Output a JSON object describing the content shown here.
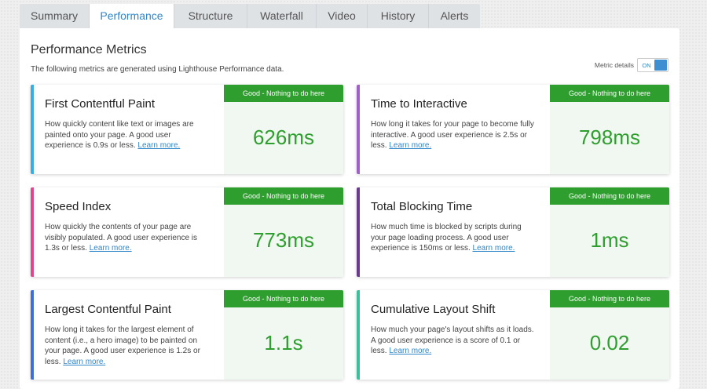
{
  "tabs": [
    {
      "label": "Summary",
      "active": false
    },
    {
      "label": "Performance",
      "active": true
    },
    {
      "label": "Structure",
      "active": false
    },
    {
      "label": "Waterfall",
      "active": false
    },
    {
      "label": "Video",
      "active": false
    },
    {
      "label": "History",
      "active": false
    },
    {
      "label": "Alerts",
      "active": false
    }
  ],
  "panel": {
    "title": "Performance Metrics",
    "subtitle": "The following metrics are generated using Lighthouse Performance data.",
    "toggle_label": "Metric details",
    "toggle_state": "ON"
  },
  "colors": {
    "accent": "#2f86c8",
    "good": "#2e9e2e"
  },
  "metrics": [
    {
      "name": "First Contentful Paint",
      "description": "How quickly content like text or images are painted onto your page. A good user experience is 0.9s or less.",
      "link": "Learn more.",
      "badge": "Good - Nothing to do here",
      "value": "626ms",
      "bar_color": "#37aee2"
    },
    {
      "name": "Time to Interactive",
      "description": "How long it takes for your page to become fully interactive. A good user experience is 2.5s or less.",
      "link": "Learn more.",
      "badge": "Good - Nothing to do here",
      "value": "798ms",
      "bar_color": "#a061c6"
    },
    {
      "name": "Speed Index",
      "description": "How quickly the contents of your page are visibly populated. A good user experience is 1.3s or less.",
      "link": "Learn more.",
      "badge": "Good - Nothing to do here",
      "value": "773ms",
      "bar_color": "#e0468f"
    },
    {
      "name": "Total Blocking Time",
      "description": "How much time is blocked by scripts during your page loading process. A good user experience is 150ms or less.",
      "link": "Learn more.",
      "badge": "Good - Nothing to do here",
      "value": "1ms",
      "bar_color": "#6b3a8c"
    },
    {
      "name": "Largest Contentful Paint",
      "description": "How long it takes for the largest element of content (i.e., a hero image) to be painted on your page. A good user experience is 1.2s or less.",
      "link": "Learn more.",
      "badge": "Good - Nothing to do here",
      "value": "1.1s",
      "bar_color": "#3d6fd6"
    },
    {
      "name": "Cumulative Layout Shift",
      "description": "How much your page's layout shifts as it loads. A good user experience is a score of 0.1 or less.",
      "link": "Learn more.",
      "badge": "Good - Nothing to do here",
      "value": "0.02",
      "bar_color": "#3cbf9a"
    }
  ]
}
